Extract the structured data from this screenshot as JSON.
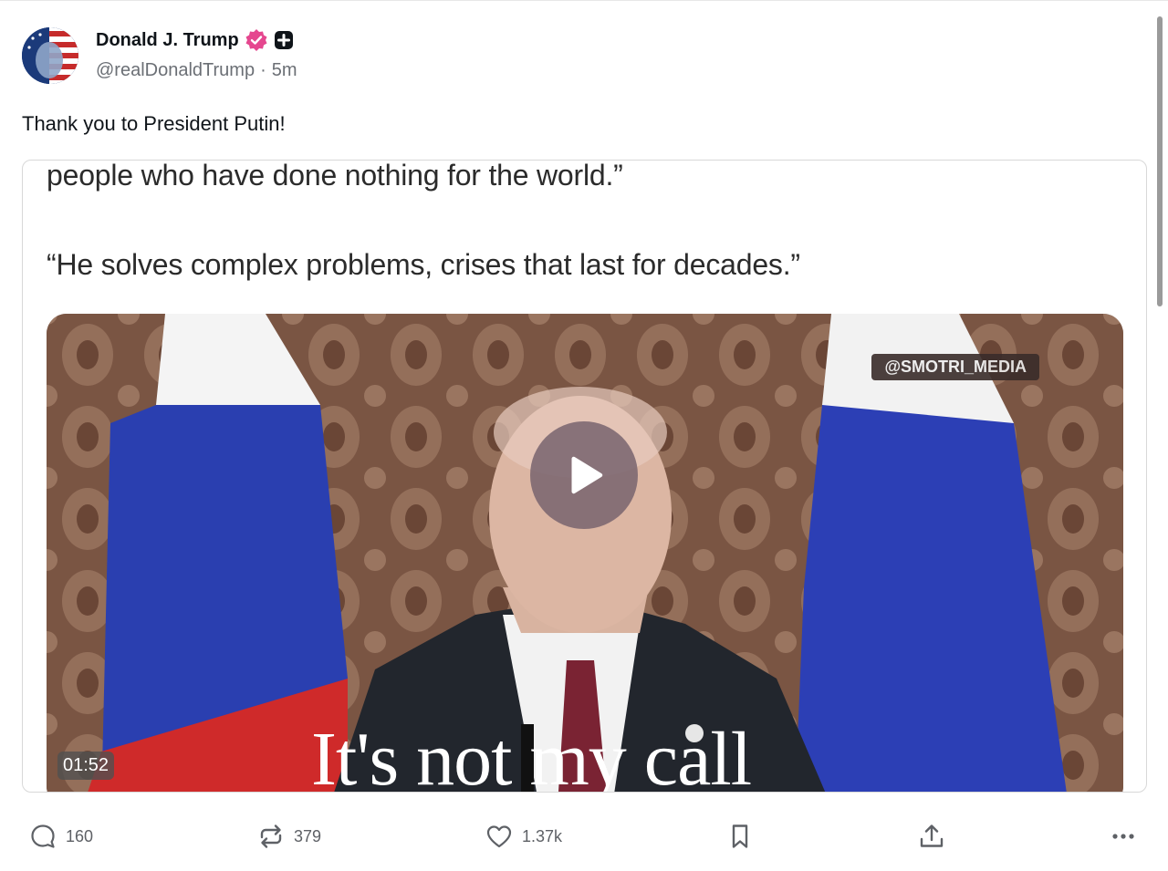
{
  "post": {
    "author": {
      "display_name": "Donald J. Trump",
      "handle": "@realDonaldTrump",
      "separator": "·",
      "time_ago": "5m",
      "verified_icon": "verified-badge-icon",
      "plus_icon": "plus-badge-icon"
    },
    "text": "Thank you to President Putin!",
    "media": {
      "quote_line_1": "people who have done nothing for the world.”",
      "quote_line_2": "“He solves complex problems, crises that last for decades.”",
      "video": {
        "watermark": "@SMOTRI_MEDIA",
        "subtitle": "It's not my call",
        "duration": "01:52",
        "play_icon": "play-icon"
      }
    },
    "actions": {
      "reply_count": "160",
      "retruth_count": "379",
      "like_count": "1.37k"
    }
  },
  "colors": {
    "text": "#0f1419",
    "muted": "#6b6f75",
    "verified": "#e5478f",
    "border": "#d8d8d8"
  }
}
